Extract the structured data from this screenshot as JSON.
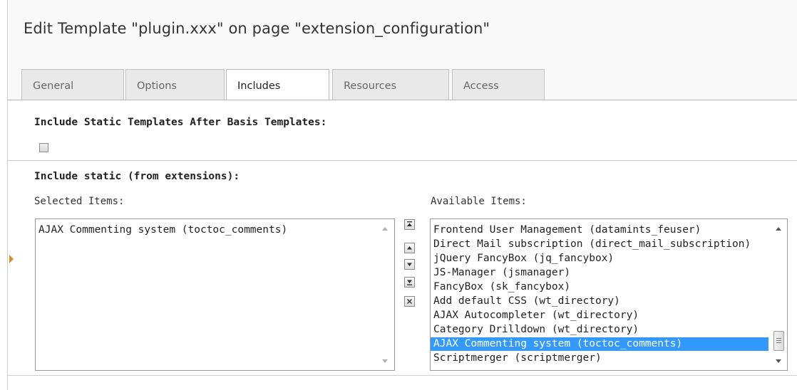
{
  "page_title": "Edit Template \"plugin.xxx\" on page \"extension_configuration\"",
  "tabs": [
    {
      "label": "General",
      "active": false
    },
    {
      "label": "Options",
      "active": false
    },
    {
      "label": "Includes",
      "active": true
    },
    {
      "label": "Resources",
      "active": false
    },
    {
      "label": "Access",
      "active": false
    }
  ],
  "include_static_after_basis": {
    "title": "Include Static Templates After Basis Templates:",
    "checked": false
  },
  "include_static": {
    "title": "Include static (from extensions):",
    "selected_label": "Selected Items:",
    "available_label": "Available Items:",
    "selected_items": [
      "AJAX Commenting system (toctoc_comments)"
    ],
    "available_items": [
      "Frontend User Management (datamints_feuser)",
      "Direct Mail subscription (direct_mail_subscription)",
      "jQuery FancyBox (jq_fancybox)",
      "JS-Manager (jsmanager)",
      "FancyBox (sk_fancybox)",
      "Add default CSS (wt_directory)",
      "AJAX Autocompleter (wt_directory)",
      "Category Drilldown (wt_directory)",
      "AJAX Commenting system (toctoc_comments)",
      "Scriptmerger (scriptmerger)"
    ],
    "available_selected": "AJAX Commenting system (toctoc_comments)",
    "move_buttons": [
      "move-to-top-icon",
      "move-up-icon",
      "move-down-icon",
      "move-to-bottom-icon",
      "remove-icon"
    ]
  },
  "colors": {
    "selection": "#3399ff",
    "marker": "#e08a2c",
    "header_bg": "#f9f9f9"
  }
}
